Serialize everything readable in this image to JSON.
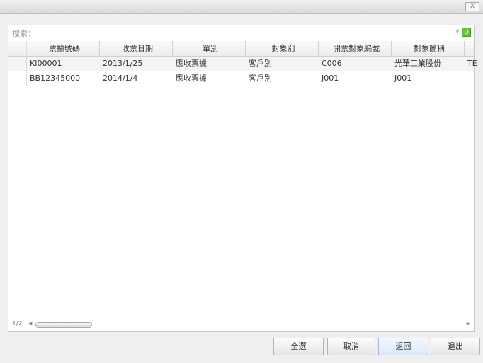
{
  "window": {
    "close_label": "X"
  },
  "search": {
    "placeholder": "搜索：",
    "go_icon": "Q"
  },
  "grid": {
    "columns": [
      "票據號碼",
      "收票日期",
      "單別",
      "對象別",
      "開票對象編號",
      "對象簡稱"
    ],
    "rows": [
      {
        "cells": [
          "KI00001",
          "2013/1/25",
          "應收票據",
          "客戶別",
          "C006",
          "光華工業股份",
          "TE"
        ]
      },
      {
        "cells": [
          "BB12345000",
          "2014/1/4",
          "應收票據",
          "客戶別",
          "J001",
          "J001",
          ""
        ]
      }
    ],
    "page": "1/2"
  },
  "buttons": {
    "select_all": "全選",
    "cancel": "取消",
    "back": "返回",
    "exit": "退出"
  }
}
